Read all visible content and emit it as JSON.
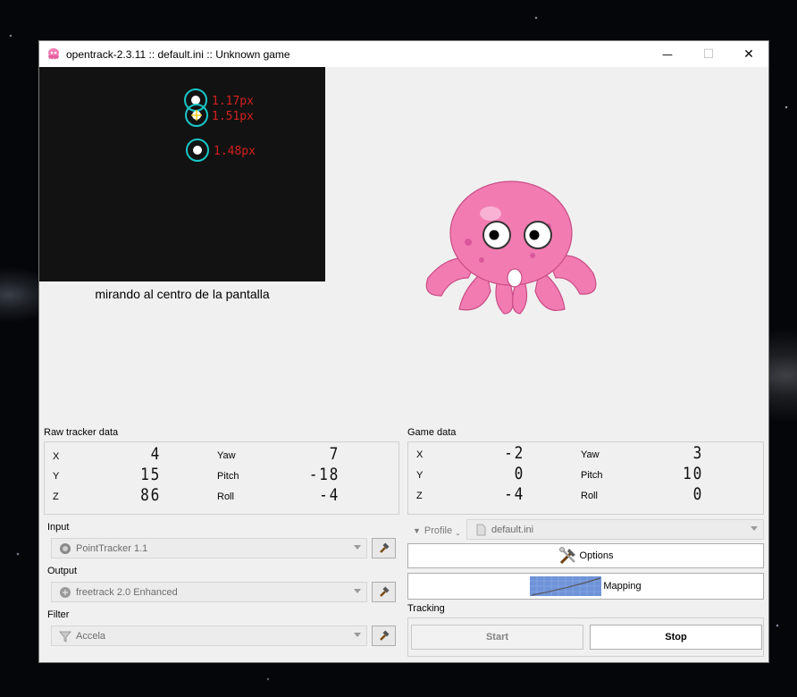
{
  "window": {
    "title": "opentrack-2.3.11 :: default.ini :: Unknown game",
    "minimize_glyph": "—",
    "maximize_glyph": "☐",
    "close_glyph": "✕"
  },
  "camera": {
    "caption": "mirando al centro de la pantalla",
    "points": [
      {
        "label": "1.17px"
      },
      {
        "label": "1.51px"
      },
      {
        "label": "1.48px"
      }
    ]
  },
  "raw_tracker": {
    "title": "Raw tracker data",
    "rows": [
      {
        "axis": "X",
        "value": "4",
        "rot_label": "Yaw",
        "rot_value": "7"
      },
      {
        "axis": "Y",
        "value": "15",
        "rot_label": "Pitch",
        "rot_value": "-18"
      },
      {
        "axis": "Z",
        "value": "86",
        "rot_label": "Roll",
        "rot_value": "-4"
      }
    ]
  },
  "game_data": {
    "title": "Game data",
    "rows": [
      {
        "axis": "X",
        "value": "-2",
        "rot_label": "Yaw",
        "rot_value": "3"
      },
      {
        "axis": "Y",
        "value": "0",
        "rot_label": "Pitch",
        "rot_value": "10"
      },
      {
        "axis": "Z",
        "value": "-4",
        "rot_label": "Roll",
        "rot_value": "0"
      }
    ]
  },
  "input": {
    "label": "Input",
    "value": "PointTracker 1.1"
  },
  "output": {
    "label": "Output",
    "value": "freetrack 2.0 Enhanced"
  },
  "filter": {
    "label": "Filter",
    "value": "Accela"
  },
  "profile": {
    "label": "Profile",
    "value": "default.ini"
  },
  "buttons": {
    "options": "Options",
    "mapping": "Mapping",
    "start": "Start",
    "stop": "Stop"
  },
  "tracking": {
    "label": "Tracking"
  },
  "colors": {
    "octopus": "#f27cb1",
    "tracker_circle": "#19c6c6",
    "tracker_text": "#d42020"
  }
}
